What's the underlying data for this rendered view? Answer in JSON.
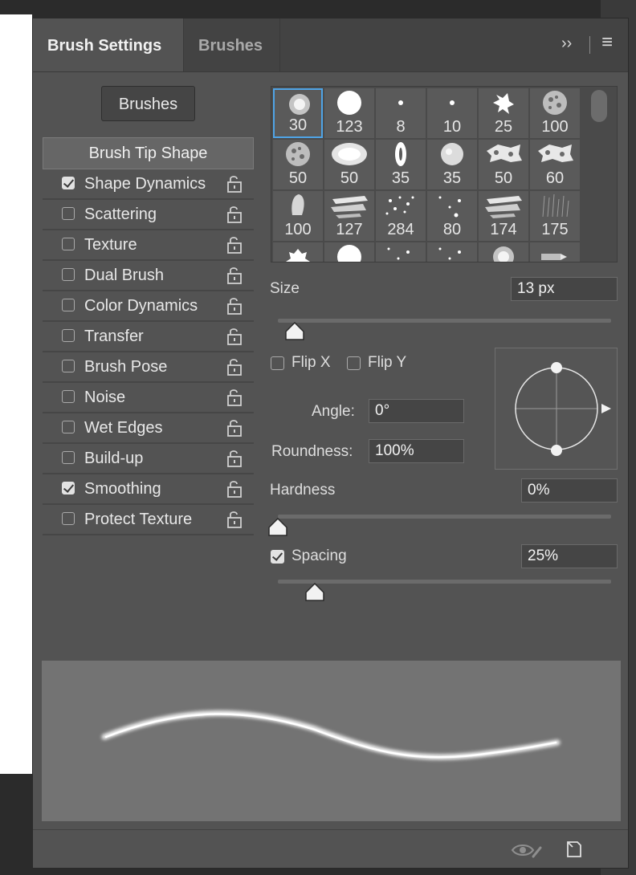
{
  "tabs": {
    "active": "Brush Settings",
    "inactive": "Brushes"
  },
  "panel_controls": {
    "expand_glyph": "››",
    "menu_glyph": "≡"
  },
  "brushes_button": "Brushes",
  "options": [
    {
      "label": "Brush Tip Shape",
      "header": true
    },
    {
      "label": "Shape Dynamics",
      "checked": true,
      "lock_icon": "unlock-icon"
    },
    {
      "label": "Scattering",
      "checked": false,
      "lock_icon": "unlock-icon"
    },
    {
      "label": "Texture",
      "checked": false,
      "lock_icon": "unlock-icon"
    },
    {
      "label": "Dual Brush",
      "checked": false,
      "lock_icon": "unlock-icon"
    },
    {
      "label": "Color Dynamics",
      "checked": false,
      "lock_icon": "unlock-icon"
    },
    {
      "label": "Transfer",
      "checked": false,
      "lock_icon": "unlock-icon"
    },
    {
      "label": "Brush Pose",
      "checked": false,
      "lock_icon": "unlock-icon"
    },
    {
      "label": "Noise",
      "checked": false,
      "lock_icon": "unlock-icon"
    },
    {
      "label": "Wet Edges",
      "checked": false,
      "lock_icon": "unlock-icon"
    },
    {
      "label": "Build-up",
      "checked": false,
      "lock_icon": "unlock-icon"
    },
    {
      "label": "Smoothing",
      "checked": true,
      "lock_icon": "unlock-icon"
    },
    {
      "label": "Protect Texture",
      "checked": false,
      "lock_icon": "unlock-icon"
    }
  ],
  "brush_presets": [
    {
      "size": "30",
      "tip": "soft-round",
      "selected": true
    },
    {
      "size": "123",
      "tip": "hard-round"
    },
    {
      "size": "8",
      "tip": "small-dot"
    },
    {
      "size": "10",
      "tip": "small-dot"
    },
    {
      "size": "25",
      "tip": "splatter"
    },
    {
      "size": "100",
      "tip": "textured-round"
    },
    {
      "size": "50",
      "tip": "textured-round"
    },
    {
      "size": "50",
      "tip": "chalk-oval"
    },
    {
      "size": "35",
      "tip": "oval-bristle"
    },
    {
      "size": "35",
      "tip": "soft-texture"
    },
    {
      "size": "50",
      "tip": "dry-media"
    },
    {
      "size": "60",
      "tip": "dry-media"
    },
    {
      "size": "100",
      "tip": "bristle-tip"
    },
    {
      "size": "127",
      "tip": "streak"
    },
    {
      "size": "284",
      "tip": "scatter-dots"
    },
    {
      "size": "80",
      "tip": "sparse-dots"
    },
    {
      "size": "174",
      "tip": "streak"
    },
    {
      "size": "175",
      "tip": "grass"
    },
    {
      "size": "",
      "tip": "leaf"
    },
    {
      "size": "",
      "tip": "hard-round"
    },
    {
      "size": "",
      "tip": "sparse-dots"
    },
    {
      "size": "",
      "tip": "sparse-dots"
    },
    {
      "size": "",
      "tip": "soft-round"
    },
    {
      "size": "",
      "tip": "pencil"
    }
  ],
  "size": {
    "label": "Size",
    "value": "13 px",
    "slider_fraction": 0.05
  },
  "flip_x": {
    "label": "Flip X",
    "checked": false
  },
  "flip_y": {
    "label": "Flip Y",
    "checked": false
  },
  "angle": {
    "label": "Angle:",
    "value": "0°"
  },
  "roundness": {
    "label": "Roundness:",
    "value": "100%"
  },
  "hardness": {
    "label": "Hardness",
    "value": "0%",
    "slider_fraction": 0.0
  },
  "spacing": {
    "label": "Spacing",
    "value": "25%",
    "checked": true,
    "slider_fraction": 0.11
  },
  "footer": {
    "visibility_icon": "eye-brush-icon",
    "new_preset_icon": "new-preset-icon"
  },
  "colors": {
    "panel": "#535353",
    "selection": "#4fa4e6",
    "preview": "#737373"
  }
}
